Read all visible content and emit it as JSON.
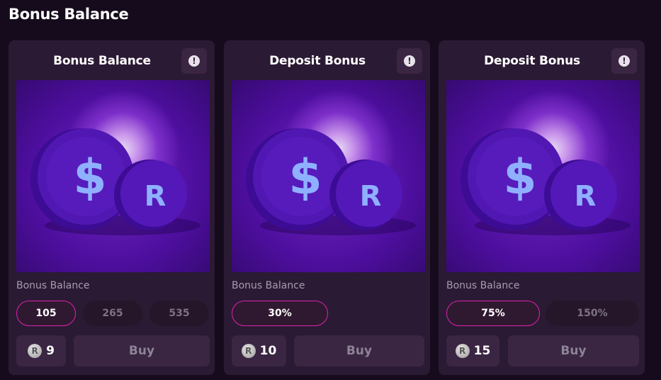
{
  "page": {
    "title": "Bonus Balance"
  },
  "cards": [
    {
      "title": "Bonus Balance",
      "info_icon": "info-icon",
      "label": "Bonus Balance",
      "options": [
        "105",
        "265",
        "535"
      ],
      "selected": "105",
      "price": "9",
      "buy_label": "Buy"
    },
    {
      "title": "Deposit Bonus",
      "info_icon": "info-icon",
      "label": "Bonus Balance",
      "options": [
        "30%"
      ],
      "selected": "30%",
      "price": "10",
      "buy_label": "Buy"
    },
    {
      "title": "Deposit Bonus",
      "info_icon": "info-icon",
      "label": "Bonus Balance",
      "options": [
        "75%",
        "150%"
      ],
      "selected": "75%",
      "price": "15",
      "buy_label": "Buy"
    }
  ],
  "art": {
    "dollar_coin_symbol": "$",
    "r_coin_symbol": "R",
    "price_coin_symbol": "R"
  },
  "colors": {
    "accent": "#e021b0",
    "card_bg": "#2b1a33",
    "page_bg": "#160b1c"
  }
}
